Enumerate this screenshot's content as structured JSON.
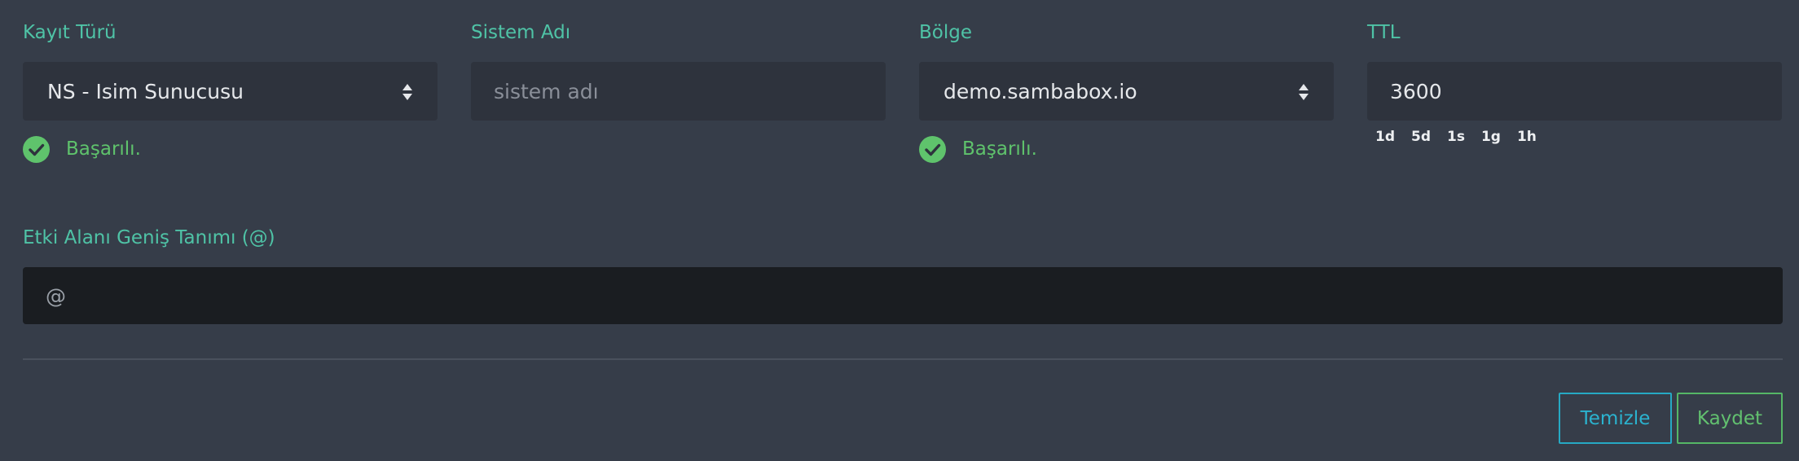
{
  "form": {
    "record_type": {
      "label": "Kayıt Türü",
      "value": "NS - Isim Sunucusu",
      "status": "Başarılı."
    },
    "system_name": {
      "label": "Sistem Adı",
      "placeholder": "sistem adı"
    },
    "zone": {
      "label": "Bölge",
      "value": "demo.sambabox.io",
      "status": "Başarılı."
    },
    "ttl": {
      "label": "TTL",
      "value": "3600",
      "presets": [
        "1d",
        "5d",
        "1s",
        "1g",
        "1h"
      ]
    },
    "fqdn": {
      "label": "Etki Alanı Geniş Tanımı (@)",
      "placeholder": "@"
    }
  },
  "actions": {
    "clear_label": "Temizle",
    "save_label": "Kaydet"
  },
  "colors": {
    "background": "#363d49",
    "label": "#4fc3a6",
    "success": "#5fc36c",
    "clear_accent": "#26a9c4",
    "save_accent": "#55b766"
  },
  "icons": {
    "status": "check-circle-icon",
    "select": "sort-arrows-icon"
  }
}
